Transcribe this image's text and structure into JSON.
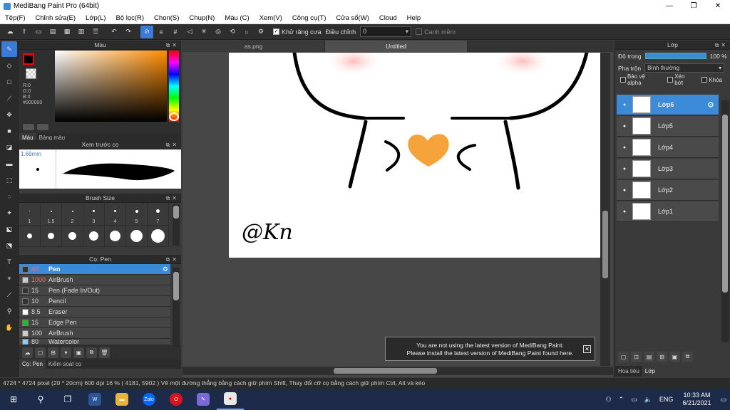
{
  "window": {
    "title": "MediBang Paint Pro (64bit)",
    "minimize": "—",
    "maximize": "❐",
    "close": "✕"
  },
  "menu": [
    "Tệp(F)",
    "Chỉnh sửa(E)",
    "Lớp(L)",
    "Bộ lọc(R)",
    "Chọn(S)",
    "Chụp(N)",
    "Màu (C)",
    "Xem(V)",
    "Công cụ(T)",
    "Cửa sổ(W)",
    "Cloud",
    "Help"
  ],
  "toolbar": {
    "antialias_label": "Khử răng cưa",
    "adjust_label": "Điều chỉnh",
    "adjust_value": "0",
    "snap_label": "Canh mềm"
  },
  "color_panel": {
    "title": "Màu",
    "rgb_r": "R:0",
    "rgb_g": "G:0",
    "rgb_b": "B:0",
    "hex": "#000000",
    "tab_color": "Màu",
    "tab_palette": "Bảng màu",
    "fg_color": "#000000",
    "hue_color": "#ff8c00"
  },
  "preview_panel": {
    "title": "Xem trước cọ",
    "size": "1.69mm"
  },
  "size_panel": {
    "title": "Brush Size",
    "labels": [
      "1",
      "1.5",
      "2",
      "3",
      "4",
      "5",
      "7"
    ]
  },
  "brush_panel": {
    "title": "Cọ: Pen",
    "brushes": [
      {
        "size": "40",
        "name": "Pen",
        "color": "#333333"
      },
      {
        "size": "1000",
        "name": "AirBrush",
        "color": "#cccccc"
      },
      {
        "size": "15",
        "name": "Pen (Fade In/Out)",
        "color": "#333333"
      },
      {
        "size": "10",
        "name": "Pencil",
        "color": "#333333"
      },
      {
        "size": "8.5",
        "name": "Eraser",
        "color": "#ffffff"
      },
      {
        "size": "15",
        "name": "Edge Pen",
        "color": "#22bb22"
      },
      {
        "size": "100",
        "name": "AirBrush",
        "color": "#cccccc"
      },
      {
        "size": "80",
        "name": "Watercolor",
        "color": "#88ccff"
      }
    ],
    "tab_pen": "Cọ: Pen",
    "tab_control": "Kiểm soát cọ"
  },
  "doc_tabs": [
    "as.png",
    "Untitled"
  ],
  "notice": {
    "line1": "You are not using the latest version of MediBang Paint.",
    "line2": "Please install the latest version of MediBang Paint found here.",
    "close": "✕"
  },
  "layer_panel": {
    "title": "Lớp",
    "opacity_label": "Độ trong",
    "opacity_value": "100 %",
    "opacity": 1.0,
    "blend_label": "Pha trộn",
    "blend_value": "Bình thường",
    "protect_alpha": "Bảo vệ alpha",
    "clipping": "Xén bớt",
    "lock": "Khóa",
    "layers": [
      "Lớp6",
      "Lớp5",
      "Lớp4",
      "Lớp3",
      "Lớp2",
      "Lớp1"
    ],
    "tab_hint": "Hoa tiêu",
    "tab_layers": "Lớp"
  },
  "status": {
    "text": "4724 * 4724 pixel   (20 * 20cm)   600 dpi   16 %   ( 4181, 5902 )   Vẽ một đường thẳng bằng cách giữ phím Shift, Thay đổi cỡ cọ bằng cách giữ phím Ctrl, Alt và kéo"
  },
  "taskbar": {
    "lang": "ENG",
    "time": "10:33 AM",
    "date": "6/21/2021",
    "zalo": "Zalo"
  },
  "canvas_signature": "@Kn"
}
